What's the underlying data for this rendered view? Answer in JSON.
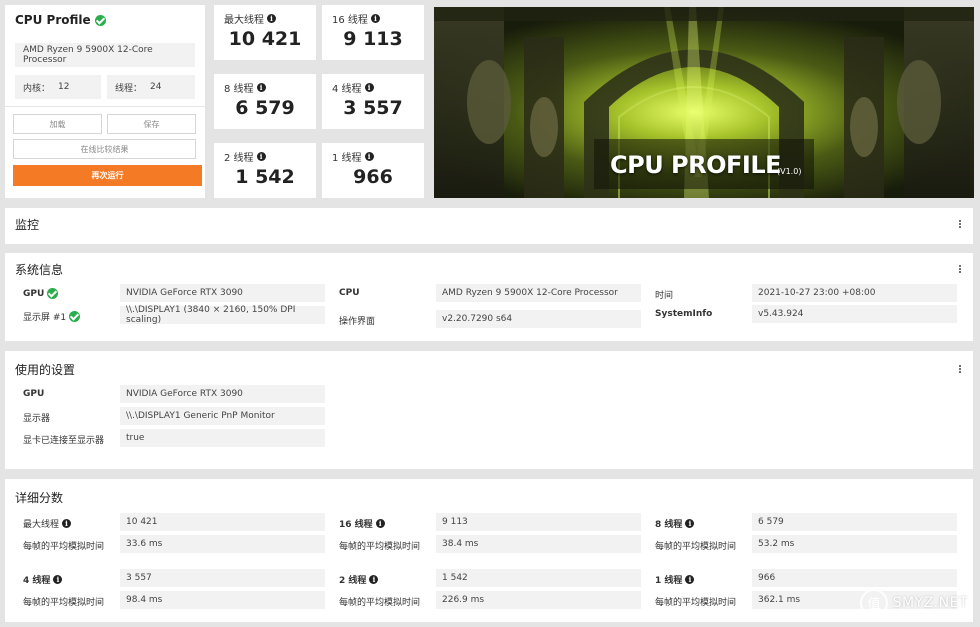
{
  "profile": {
    "title": "CPU Profile",
    "cpu_name": "AMD Ryzen 9 5900X 12-Core Processor",
    "cores_label": "内核：",
    "cores_value": "12",
    "threads_label": "线程：",
    "threads_value": "24",
    "load_label": "加载",
    "save_label": "保存",
    "compare_label": "在线比较结果",
    "run_label": "再次运行",
    "accent": "#f47a25"
  },
  "scores": [
    {
      "label": "最大线程",
      "value": "10 421"
    },
    {
      "label": "16 线程",
      "value": "9 113"
    },
    {
      "label": "8 线程",
      "value": "6 579"
    },
    {
      "label": "4 线程",
      "value": "3 557"
    },
    {
      "label": "2 线程",
      "value": "1 542"
    },
    {
      "label": "1 线程",
      "value": "966"
    }
  ],
  "hero": {
    "title": "CPU PROFILE",
    "version": "(V1.0)"
  },
  "monitor": {
    "title": "监控"
  },
  "sysinfo": {
    "title": "系统信息",
    "gpu_label": "GPU",
    "gpu_value": "NVIDIA GeForce RTX 3090",
    "display_label": "显示屏 #1",
    "display_value": "\\\\.\\DISPLAY1 (3840 × 2160, 150% DPI scaling)",
    "cpu_label": "CPU",
    "cpu_value": "AMD Ryzen 9 5900X 12-Core Processor",
    "os_label": "操作界面",
    "os_value": "v2.20.7290 s64",
    "time_label": "时间",
    "time_value": "2021-10-27 23:00 +08:00",
    "sysinfo_label": "SystemInfo",
    "sysinfo_value": "v5.43.924"
  },
  "settings": {
    "title": "使用的设置",
    "gpu_label": "GPU",
    "gpu_value": "NVIDIA GeForce RTX 3090",
    "display_label": "显示器",
    "display_value": "\\\\.\\DISPLAY1 Generic PnP Monitor",
    "connected_label": "显卡已连接至显示器",
    "connected_value": "true"
  },
  "details": {
    "title": "详细分数",
    "frame_label": "每帧的平均模拟时间",
    "items": [
      {
        "label": "最大线程",
        "score": "10 421",
        "time": "33.6 ms"
      },
      {
        "label": "16 线程",
        "score": "9 113",
        "time": "38.4 ms"
      },
      {
        "label": "8 线程",
        "score": "6 579",
        "time": "53.2 ms"
      },
      {
        "label": "4 线程",
        "score": "3 557",
        "time": "98.4 ms"
      },
      {
        "label": "2 线程",
        "score": "1 542",
        "time": "226.9 ms"
      },
      {
        "label": "1 线程",
        "score": "966",
        "time": "362.1 ms"
      }
    ]
  },
  "watermark": {
    "text": "SMYZ.NET",
    "logo_text": "值"
  }
}
